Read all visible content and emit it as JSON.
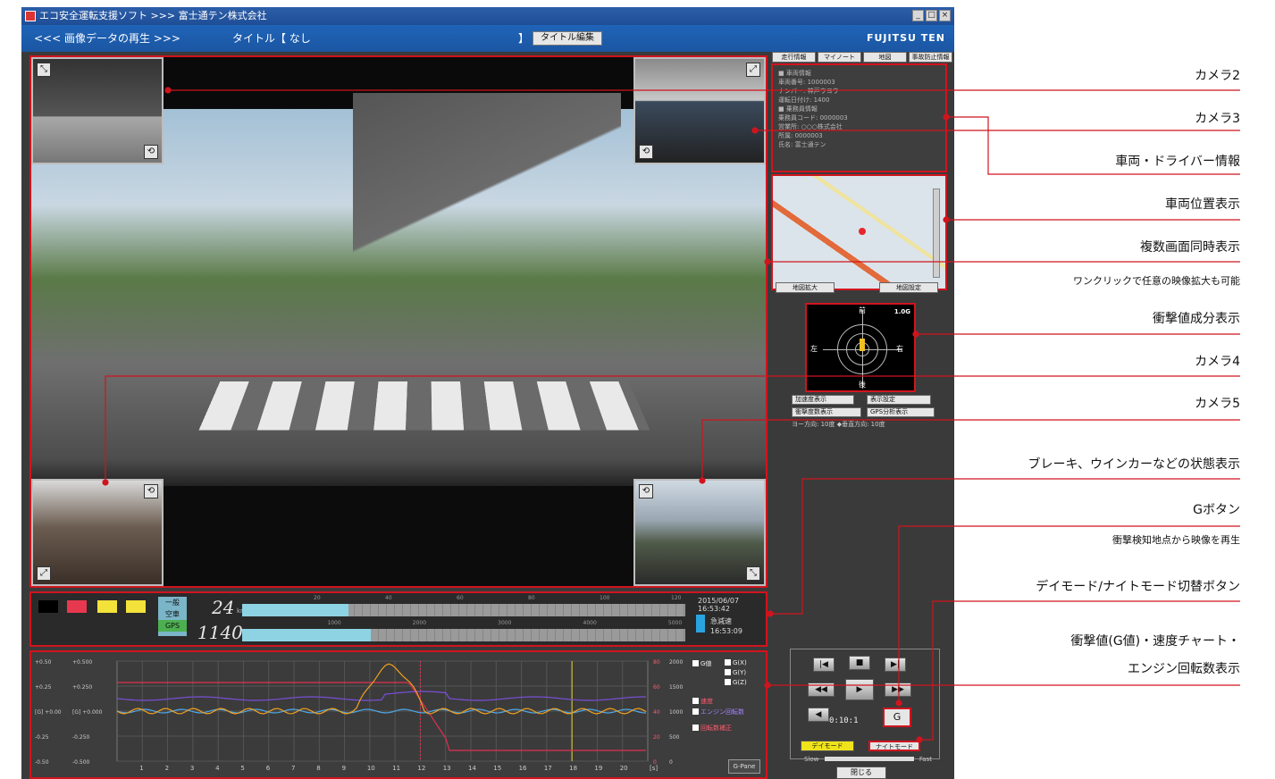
{
  "window": {
    "title": "エコ安全運転支援ソフト >>> 富士通テン株式会社",
    "controls": [
      "_",
      "□",
      "×"
    ]
  },
  "header": {
    "mode_label": "<<< 画像データの再生 >>>",
    "title_label": "タイトル【 なし",
    "separator": "】",
    "title_edit_button": "タイトル編集",
    "brand": "FUJITSU TEN"
  },
  "cameras": {
    "icon_expand": "expand-icon",
    "icon_rotate": "rotate-icon"
  },
  "status": {
    "squares": [
      "#000000",
      "#e8384f",
      "#f3e23a",
      "#f3e23a"
    ],
    "gps_lines": [
      "一般",
      "空車",
      "GPS"
    ],
    "speed_value": "24",
    "speed_unit": "km/h",
    "rpm_value": "1140",
    "rpm_unit": "rpm",
    "speed_fill": 0.24,
    "rpm_fill": 0.29,
    "speed_scale": [
      "20",
      "40",
      "60",
      "80",
      "100",
      "120"
    ],
    "rpm_scale": [
      "1000",
      "2000",
      "3000",
      "4000",
      "5000"
    ],
    "timestamp": "2015/06/07 16:53:42",
    "event_label": "急減速",
    "event_time": "16:53:09"
  },
  "chart": {
    "left_ticks_g": [
      "+0.50",
      "+0.25",
      "[G] +0.00",
      "-0.25",
      "-0.50"
    ],
    "left_ticks_yaw": [
      "+0.500",
      "+0.250",
      "[G] +0.000",
      "-0.250",
      "-0.500"
    ],
    "right_ticks_speed": [
      "80",
      "60",
      "40",
      "20",
      "0"
    ],
    "right_ticks_rpm": [
      "2000",
      "1500",
      "1000",
      "500",
      "0"
    ],
    "x_ticks": [
      "1",
      "2",
      "3",
      "4",
      "5",
      "6",
      "7",
      "8",
      "9",
      "10",
      "11",
      "12",
      "13",
      "14",
      "15",
      "16",
      "17",
      "18",
      "19",
      "20"
    ],
    "x_unit": "[s]",
    "legend": [
      "G値",
      "G(X)",
      "G(Y)",
      "G(Z)",
      "速度",
      "エンジン回転数",
      "回転数補正"
    ],
    "gpane_button": "G-Pane",
    "colors": {
      "g": "#f0a020",
      "speed": "#e03050",
      "rpm": "#7a4fd8",
      "x": "#4fa8e8"
    }
  },
  "right": {
    "tabs": [
      "走行情報",
      "マイノート",
      "地図",
      "事故防止情報"
    ],
    "info_lines": [
      "■ 車両情報",
      "車両番号: 1000003",
      "ナンバー: 神戸ウヨウ",
      "運転日付け: 1400",
      "■ 乗務員情報",
      "乗務員コード: 0000003",
      "営業所: ○○○株式会社",
      "所属: 0000003",
      "氏名: 富士通テン"
    ],
    "map_buttons": [
      "地図拡大",
      "地図設定"
    ],
    "gvector": {
      "front": "前",
      "back": "後",
      "left": "左",
      "right": "右",
      "max": "1.0G"
    },
    "options": [
      "加速度表示",
      "表示設定",
      "衝撃度数表示",
      "GPS分析表示"
    ],
    "angle_info": "ヨー方向: 10度  ◆垂直方向: 10度",
    "controls": {
      "prev": "|◀",
      "stop": "■",
      "next": "▶|",
      "rewind": "◀◀",
      "play": "▶",
      "forward": "▶▶",
      "volume": "◀",
      "counter": "0:10:1",
      "g_button": "G",
      "day_mode": "デイモード",
      "night_mode": "ナイトモード",
      "speed_slow": "Slow",
      "speed_fast": "Fast",
      "close": "閉じる"
    }
  },
  "callouts": [
    "カメラ2",
    "カメラ3",
    "車両・ドライバー情報",
    "車両位置表示",
    "複数画面同時表示",
    "ワンクリックで任意の映像拡大も可能",
    "衝撃値成分表示",
    "カメラ4",
    "カメラ5",
    "ブレーキ、ウインカーなどの状態表示",
    "Gボタン",
    "衝撃検知地点から映像を再生",
    "デイモード/ナイトモード切替ボタン",
    "衝撃値(G値)・速度チャート・",
    "エンジン回転数表示"
  ]
}
